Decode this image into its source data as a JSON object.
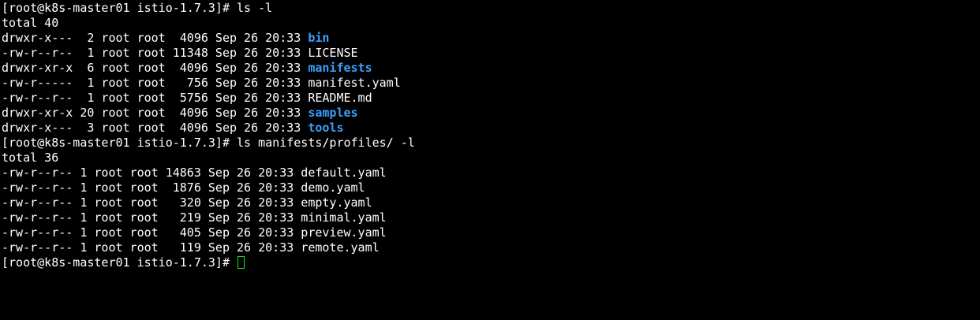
{
  "prompt": "[root@k8s-master01 istio-1.7.3]# ",
  "colors": {
    "background": "#000000",
    "text": "#ffffff",
    "directory": "#3aa0ff",
    "cursor": "#1ee01e"
  },
  "cursor_icon": "block-cursor",
  "command1": "ls -l",
  "listing1": {
    "total": "total 40",
    "entries": [
      {
        "meta": "drwxr-x---  2 root root  4096 Sep 26 20:33 ",
        "name": "bin",
        "is_dir": true
      },
      {
        "meta": "-rw-r--r--  1 root root 11348 Sep 26 20:33 ",
        "name": "LICENSE",
        "is_dir": false
      },
      {
        "meta": "drwxr-xr-x  6 root root  4096 Sep 26 20:33 ",
        "name": "manifests",
        "is_dir": true
      },
      {
        "meta": "-rw-r-----  1 root root   756 Sep 26 20:33 ",
        "name": "manifest.yaml",
        "is_dir": false
      },
      {
        "meta": "-rw-r--r--  1 root root  5756 Sep 26 20:33 ",
        "name": "README.md",
        "is_dir": false
      },
      {
        "meta": "drwxr-xr-x 20 root root  4096 Sep 26 20:33 ",
        "name": "samples",
        "is_dir": true
      },
      {
        "meta": "drwxr-x---  3 root root  4096 Sep 26 20:33 ",
        "name": "tools",
        "is_dir": true
      }
    ]
  },
  "command2": "ls manifests/profiles/ -l",
  "listing2": {
    "total": "total 36",
    "entries": [
      {
        "meta": "-rw-r--r-- 1 root root 14863 Sep 26 20:33 ",
        "name": "default.yaml",
        "is_dir": false
      },
      {
        "meta": "-rw-r--r-- 1 root root  1876 Sep 26 20:33 ",
        "name": "demo.yaml",
        "is_dir": false
      },
      {
        "meta": "-rw-r--r-- 1 root root   320 Sep 26 20:33 ",
        "name": "empty.yaml",
        "is_dir": false
      },
      {
        "meta": "-rw-r--r-- 1 root root   219 Sep 26 20:33 ",
        "name": "minimal.yaml",
        "is_dir": false
      },
      {
        "meta": "-rw-r--r-- 1 root root   405 Sep 26 20:33 ",
        "name": "preview.yaml",
        "is_dir": false
      },
      {
        "meta": "-rw-r--r-- 1 root root   119 Sep 26 20:33 ",
        "name": "remote.yaml",
        "is_dir": false
      }
    ]
  }
}
